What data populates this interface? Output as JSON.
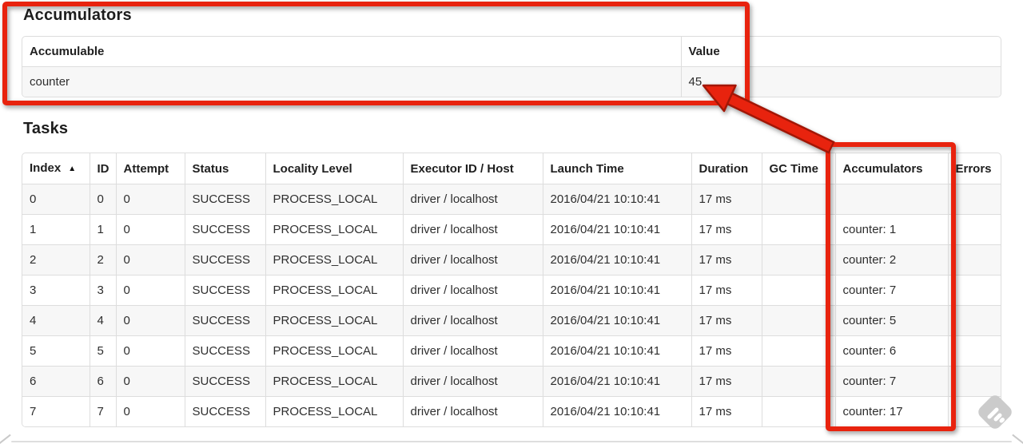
{
  "accumulators_section": {
    "title": "Accumulators",
    "table": {
      "headers": [
        "Accumulable",
        "Value"
      ],
      "rows": [
        {
          "accumulable": "counter",
          "value": "45"
        }
      ]
    }
  },
  "tasks_section": {
    "title": "Tasks",
    "table": {
      "headers": [
        "Index",
        "ID",
        "Attempt",
        "Status",
        "Locality Level",
        "Executor ID / Host",
        "Launch Time",
        "Duration",
        "GC Time",
        "Accumulators",
        "Errors"
      ],
      "sort_column": "Index",
      "sort_direction": "ascending",
      "sort_icon": "▲",
      "rows": [
        {
          "index": "0",
          "id": "0",
          "attempt": "0",
          "status": "SUCCESS",
          "locality": "PROCESS_LOCAL",
          "executor": "driver / localhost",
          "launch_time": "2016/04/21 10:10:41",
          "duration": "17 ms",
          "gc_time": "",
          "accumulators": "",
          "errors": ""
        },
        {
          "index": "1",
          "id": "1",
          "attempt": "0",
          "status": "SUCCESS",
          "locality": "PROCESS_LOCAL",
          "executor": "driver / localhost",
          "launch_time": "2016/04/21 10:10:41",
          "duration": "17 ms",
          "gc_time": "",
          "accumulators": "counter: 1",
          "errors": ""
        },
        {
          "index": "2",
          "id": "2",
          "attempt": "0",
          "status": "SUCCESS",
          "locality": "PROCESS_LOCAL",
          "executor": "driver / localhost",
          "launch_time": "2016/04/21 10:10:41",
          "duration": "17 ms",
          "gc_time": "",
          "accumulators": "counter: 2",
          "errors": ""
        },
        {
          "index": "3",
          "id": "3",
          "attempt": "0",
          "status": "SUCCESS",
          "locality": "PROCESS_LOCAL",
          "executor": "driver / localhost",
          "launch_time": "2016/04/21 10:10:41",
          "duration": "17 ms",
          "gc_time": "",
          "accumulators": "counter: 7",
          "errors": ""
        },
        {
          "index": "4",
          "id": "4",
          "attempt": "0",
          "status": "SUCCESS",
          "locality": "PROCESS_LOCAL",
          "executor": "driver / localhost",
          "launch_time": "2016/04/21 10:10:41",
          "duration": "17 ms",
          "gc_time": "",
          "accumulators": "counter: 5",
          "errors": ""
        },
        {
          "index": "5",
          "id": "5",
          "attempt": "0",
          "status": "SUCCESS",
          "locality": "PROCESS_LOCAL",
          "executor": "driver / localhost",
          "launch_time": "2016/04/21 10:10:41",
          "duration": "17 ms",
          "gc_time": "",
          "accumulators": "counter: 6",
          "errors": ""
        },
        {
          "index": "6",
          "id": "6",
          "attempt": "0",
          "status": "SUCCESS",
          "locality": "PROCESS_LOCAL",
          "executor": "driver / localhost",
          "launch_time": "2016/04/21 10:10:41",
          "duration": "17 ms",
          "gc_time": "",
          "accumulators": "counter: 7",
          "errors": ""
        },
        {
          "index": "7",
          "id": "7",
          "attempt": "0",
          "status": "SUCCESS",
          "locality": "PROCESS_LOCAL",
          "executor": "driver / localhost",
          "launch_time": "2016/04/21 10:10:41",
          "duration": "17 ms",
          "gc_time": "",
          "accumulators": "counter: 17",
          "errors": ""
        }
      ]
    }
  },
  "annotations": {
    "highlight_color": "#e8230e",
    "highlight_outline_color": "#a31605",
    "highlighted_value": "45",
    "highlighted_column": "Accumulators"
  },
  "watermark": {
    "icon": "feedly-logo-icon",
    "color": "#cbcbcb"
  }
}
